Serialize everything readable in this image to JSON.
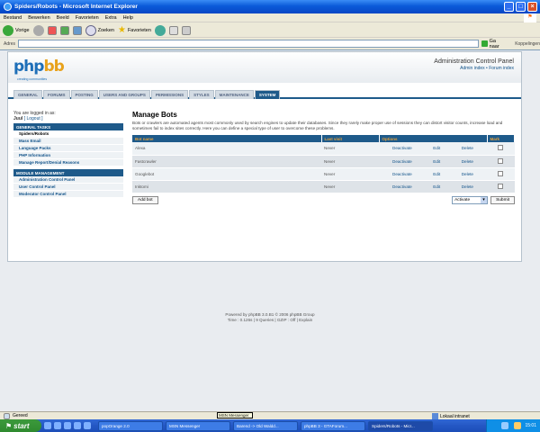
{
  "window": {
    "title": "Spiders/Robots - Microsoft Internet Explorer"
  },
  "menu": [
    "Bestand",
    "Bewerken",
    "Beeld",
    "Favorieten",
    "Extra",
    "Help"
  ],
  "toolbar": {
    "back": "Vorige",
    "search": "Zoeken",
    "favorites": "Favorieten"
  },
  "address": {
    "label": "Adres",
    "value": "",
    "go": "Ga naar",
    "links": "Koppelingen"
  },
  "header": {
    "logo_main": "php",
    "logo_accent": "bb",
    "logo_sub": "creating communities",
    "title": "Administration Control Panel",
    "links": "Admin index • Forum index"
  },
  "tabs": [
    "GENERAL",
    "FORUMS",
    "POSTING",
    "USERS AND GROUPS",
    "PERMISSIONS",
    "STYLES",
    "MAINTENANCE",
    "SYSTEM"
  ],
  "sidebar": {
    "logged_in_as": "You are logged in as:",
    "user": "Juul",
    "logout": "[ Logout ]",
    "sections": [
      {
        "title": "GENERAL TASKS",
        "items": [
          "Spiders/Robots",
          "Mass Email",
          "Language Packs",
          "PHP Information",
          "Manage Report/Denial Reasons"
        ]
      },
      {
        "title": "MODULE MANAGEMENT",
        "items": [
          "Administration Control Panel",
          "User Control Panel",
          "Moderator Control Panel"
        ]
      }
    ]
  },
  "main": {
    "title": "Manage Bots",
    "description": "Bots or crawlers are automated agents most commonly used by search engines to update their databases. Since they rarely make proper use of sessions they can distort visitor counts, increase load and sometimes fail to index sites correctly. Here you can define a special type of user to overcome these problems.",
    "columns": [
      "Bot name",
      "Last visit",
      "Options",
      "Mark"
    ],
    "bots": [
      {
        "name": "Alexa",
        "last_visit": "Never",
        "deactivate": "Deactivate",
        "edit": "Edit",
        "delete": "Delete"
      },
      {
        "name": "Fastcrawler",
        "last_visit": "Never",
        "deactivate": "Deactivate",
        "edit": "Edit",
        "delete": "Delete"
      },
      {
        "name": "Googlebot",
        "last_visit": "Never",
        "deactivate": "Deactivate",
        "edit": "Edit",
        "delete": "Delete"
      },
      {
        "name": "Inktomi",
        "last_visit": "Never",
        "deactivate": "Deactivate",
        "edit": "Edit",
        "delete": "Delete"
      }
    ],
    "add_bot": "Add bot",
    "action_select": "Activate",
    "submit": "Submit"
  },
  "footer": {
    "line1": "Powered by phpBB 3.0.B1 © 2006 phpBB Group",
    "line2": "Time : 0.126s | 9 Queries | GZIP : Off | Explain"
  },
  "status": {
    "left": "Gereed",
    "zone": "Lokaal intranet",
    "tooltip": "MSN Messenger"
  },
  "taskbar": {
    "start": "start",
    "tasks": [
      "popOrange 2.0",
      "MSN Messenger",
      "Barend -> Old Waldd...",
      "phpBB 3 - GTAForum...",
      "Spiders/Robots - Micr..."
    ],
    "clock": "15:01"
  }
}
